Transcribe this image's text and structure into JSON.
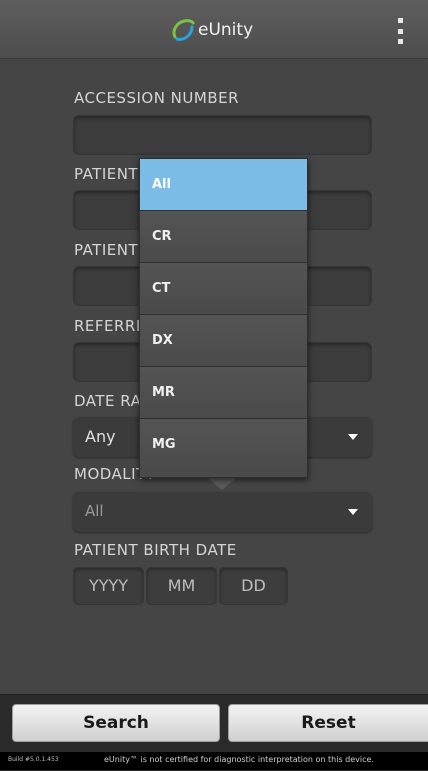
{
  "header": {
    "app_name": "eUnity",
    "logo_icon": "eunity-logo-icon",
    "menu_icon": "more-vert-icon"
  },
  "form": {
    "accession_label": "ACCESSION NUMBER",
    "accession_value": "",
    "patient_name_label": "PATIENT NAME",
    "patient_name_value": "",
    "patient_id_label": "PATIENT ID",
    "patient_id_value": "",
    "referring_label": "REFERRING PHYSICIAN",
    "referring_value": "",
    "date_range_label": "DATE RANGE",
    "date_range_value": "Any",
    "modality_label": "MODALITY",
    "modality_value": "All",
    "birth_date_label": "PATIENT BIRTH DATE",
    "birth_year_placeholder": "YYYY",
    "birth_month_placeholder": "MM",
    "birth_day_placeholder": "DD"
  },
  "modality_dropdown": {
    "options": [
      "All",
      "CR",
      "CT",
      "DX",
      "MR",
      "MG"
    ],
    "selected": "All"
  },
  "actions": {
    "search_label": "Search",
    "reset_label": "Reset"
  },
  "footer": {
    "build": "Build #5.0.1.453",
    "disclaimer": "eUnity™ is not certified for diagnostic interpretation on this device."
  },
  "colors": {
    "accent_selected": "#7cbde8",
    "background": "#454545"
  }
}
